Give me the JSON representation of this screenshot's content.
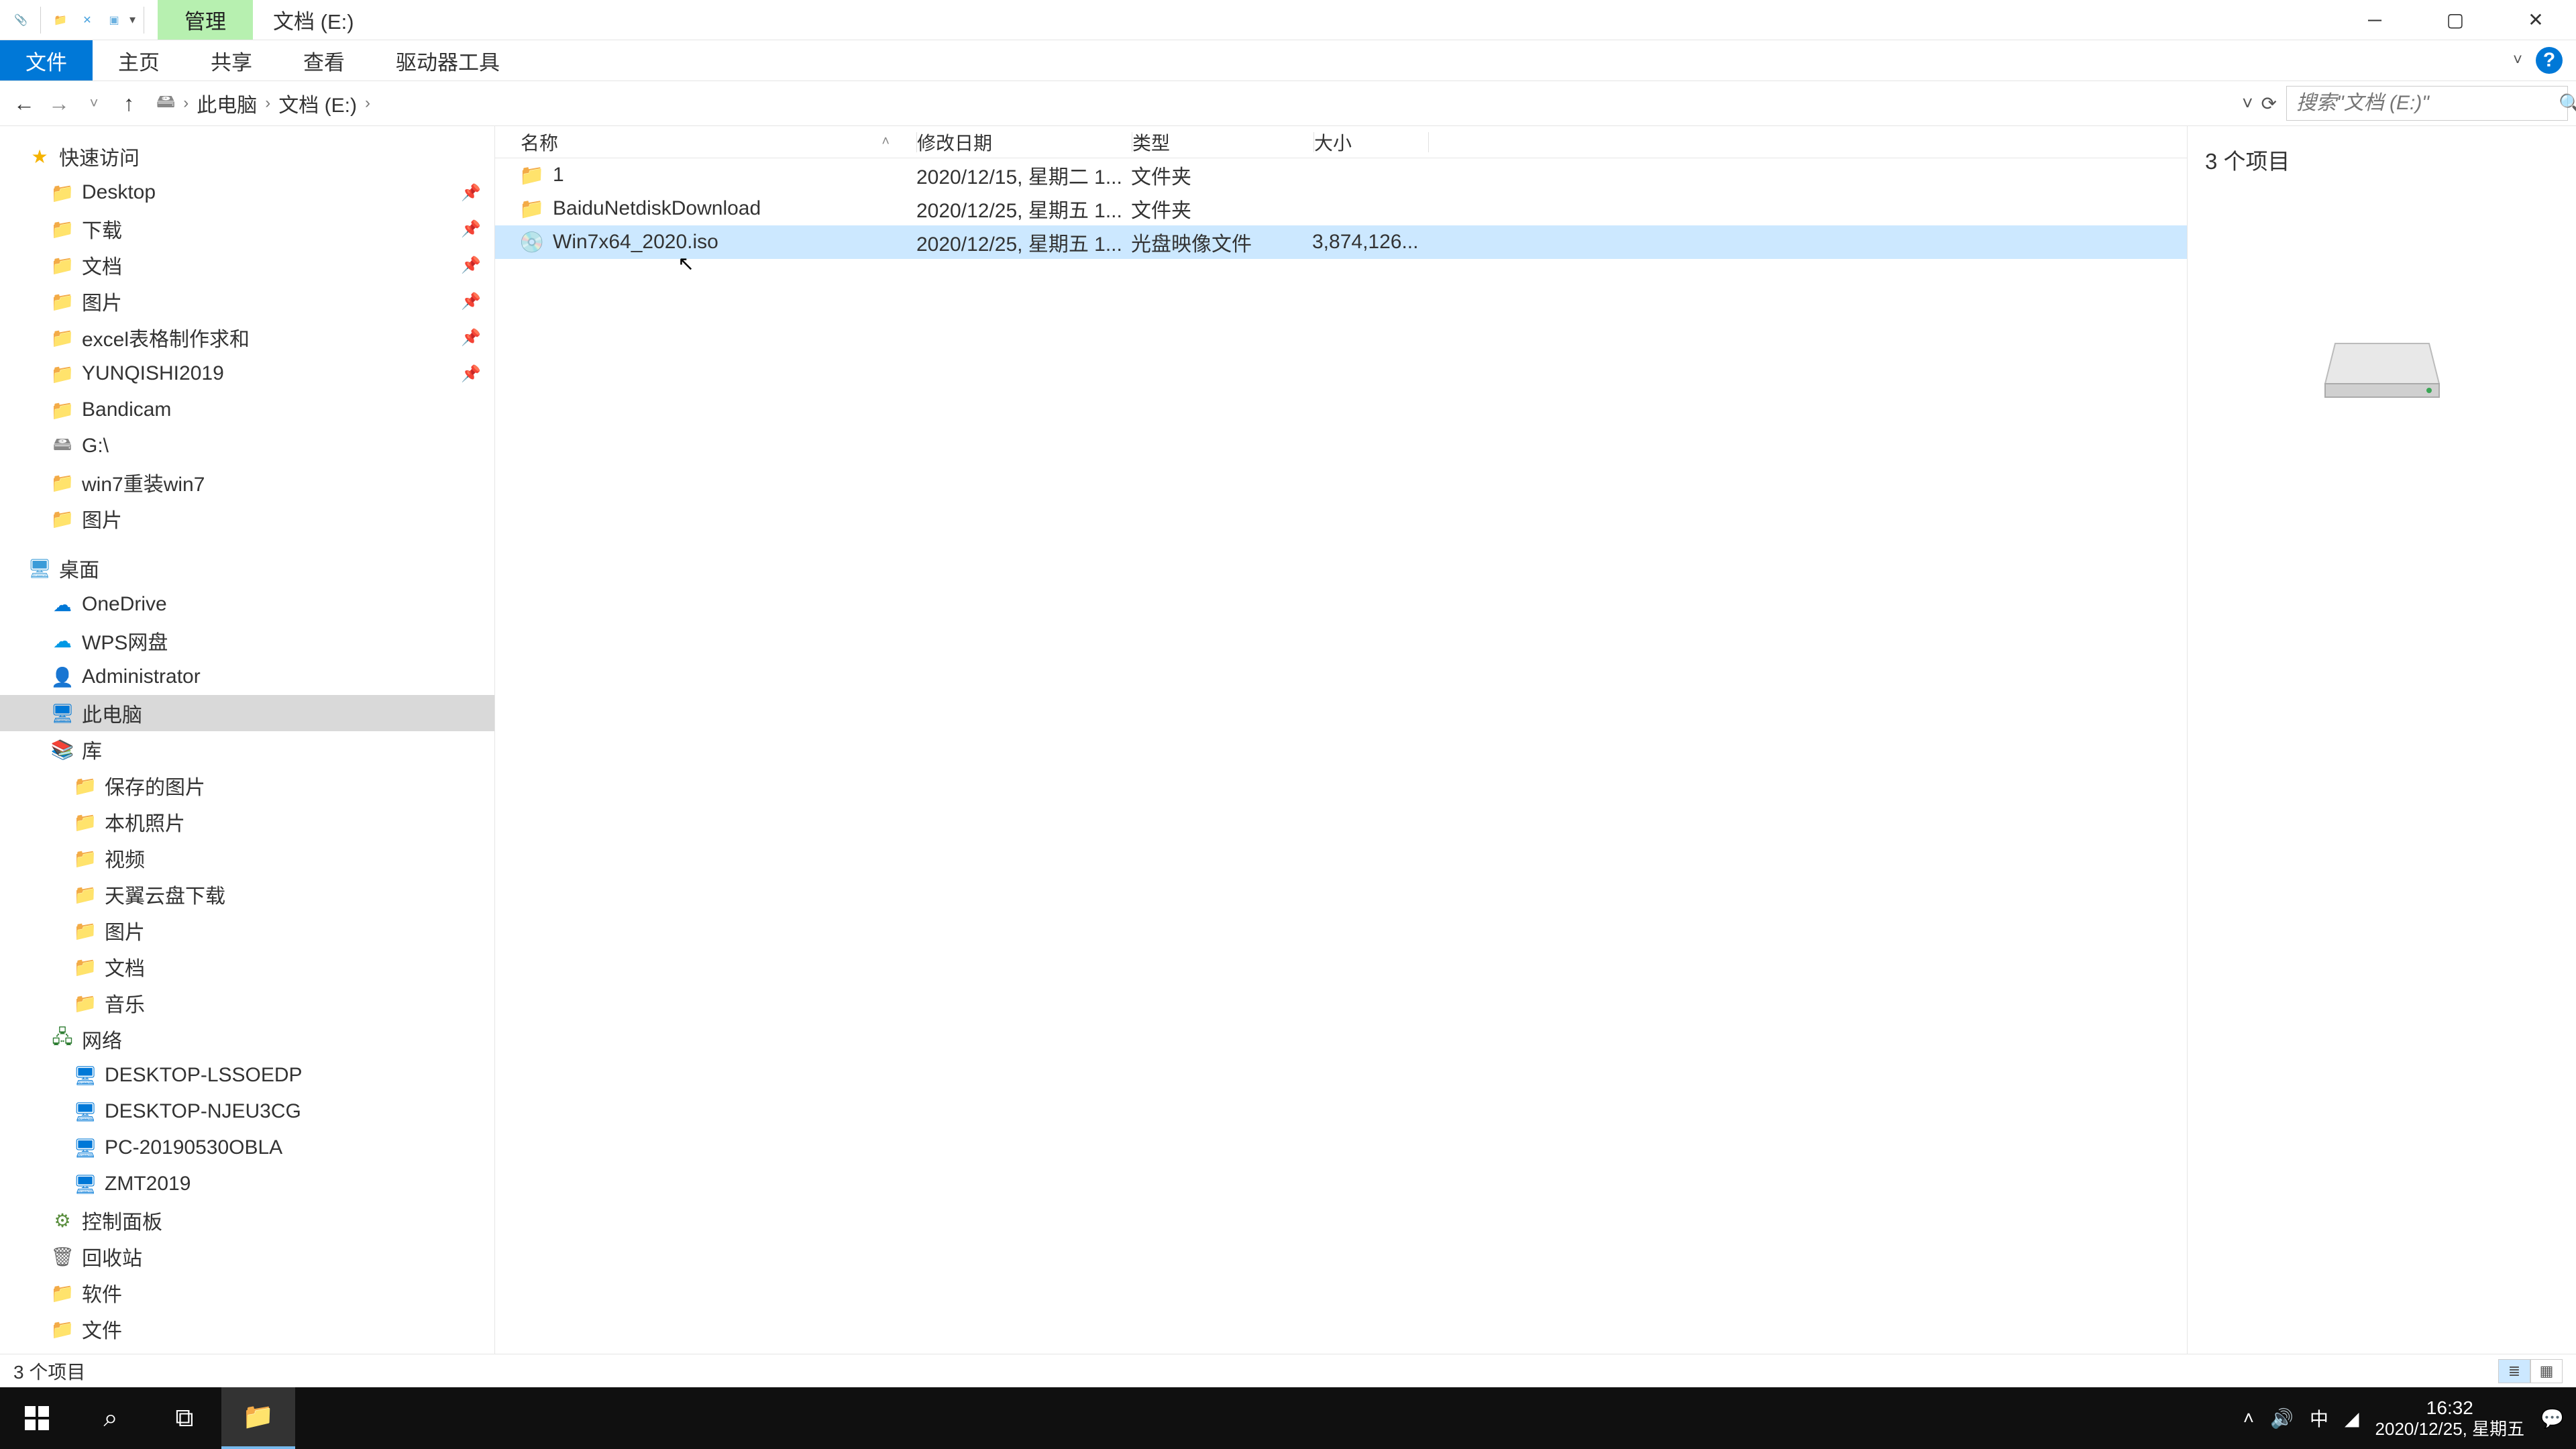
{
  "titlebar": {
    "contextual_tab": "管理",
    "caption": "文档 (E:)"
  },
  "ribbon": {
    "tabs": [
      "文件",
      "主页",
      "共享",
      "查看",
      "驱动器工具"
    ]
  },
  "breadcrumb": {
    "parts": [
      "此电脑",
      "文档 (E:)"
    ]
  },
  "search": {
    "placeholder": "搜索\"文档 (E:)\""
  },
  "columns": {
    "name": "名称",
    "date": "修改日期",
    "type": "类型",
    "size": "大小"
  },
  "files": [
    {
      "icon": "folder",
      "name": "1",
      "date": "2020/12/15, 星期二 1...",
      "type": "文件夹",
      "size": "",
      "selected": false
    },
    {
      "icon": "folder",
      "name": "BaiduNetdiskDownload",
      "date": "2020/12/25, 星期五 1...",
      "type": "文件夹",
      "size": "",
      "selected": false
    },
    {
      "icon": "disc",
      "name": "Win7x64_2020.iso",
      "date": "2020/12/25, 星期五 1...",
      "type": "光盘映像文件",
      "size": "3,874,126...",
      "selected": true
    }
  ],
  "nav": {
    "quick_access": "快速访问",
    "quick_items": [
      {
        "icon": "blue",
        "label": "Desktop",
        "pinned": true
      },
      {
        "icon": "blue",
        "label": "下载",
        "pinned": true
      },
      {
        "icon": "folder",
        "label": "文档",
        "pinned": true
      },
      {
        "icon": "blue",
        "label": "图片",
        "pinned": true
      },
      {
        "icon": "folder",
        "label": "excel表格制作求和",
        "pinned": true
      },
      {
        "icon": "folder",
        "label": "YUNQISHI2019",
        "pinned": true
      },
      {
        "icon": "folder",
        "label": "Bandicam",
        "pinned": false
      },
      {
        "icon": "drive",
        "label": "G:\\",
        "pinned": false
      },
      {
        "icon": "folder",
        "label": "win7重装win7",
        "pinned": false
      },
      {
        "icon": "folder",
        "label": "图片",
        "pinned": false
      }
    ],
    "desktop": "桌面",
    "desktop_items": [
      {
        "icon": "onedrive",
        "label": "OneDrive"
      },
      {
        "icon": "wps",
        "label": "WPS网盘"
      },
      {
        "icon": "user",
        "label": "Administrator"
      },
      {
        "icon": "pc",
        "label": "此电脑",
        "selected": true
      },
      {
        "icon": "lib",
        "label": "库"
      }
    ],
    "lib_items": [
      {
        "icon": "blue",
        "label": "保存的图片"
      },
      {
        "icon": "blue",
        "label": "本机照片"
      },
      {
        "icon": "blue",
        "label": "视频"
      },
      {
        "icon": "blue",
        "label": "天翼云盘下载"
      },
      {
        "icon": "blue",
        "label": "图片"
      },
      {
        "icon": "blue",
        "label": "文档"
      },
      {
        "icon": "blue",
        "label": "音乐"
      }
    ],
    "network": "网络",
    "network_items": [
      {
        "label": "DESKTOP-LSSOEDP"
      },
      {
        "label": "DESKTOP-NJEU3CG"
      },
      {
        "label": "PC-20190530OBLA"
      },
      {
        "label": "ZMT2019"
      }
    ],
    "tail_items": [
      {
        "icon": "panel",
        "label": "控制面板"
      },
      {
        "icon": "recycle",
        "label": "回收站"
      },
      {
        "icon": "folder",
        "label": "软件"
      },
      {
        "icon": "folder",
        "label": "文件"
      }
    ]
  },
  "preview": {
    "header": "3 个项目"
  },
  "statusbar": {
    "text": "3 个项目"
  },
  "taskbar": {
    "time": "16:32",
    "date": "2020/12/25, 星期五",
    "ime": "中"
  }
}
